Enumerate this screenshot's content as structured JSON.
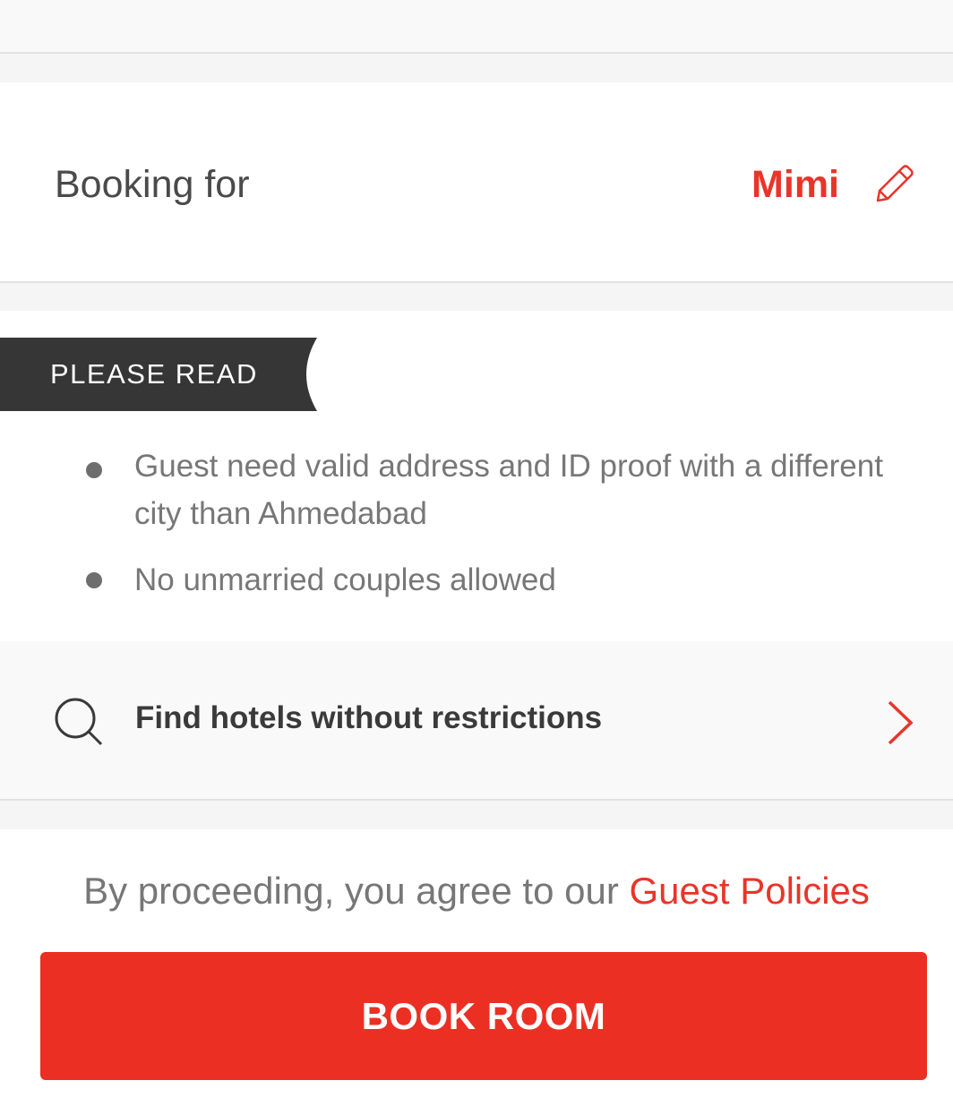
{
  "booking": {
    "label": "Booking for",
    "guest_name": "Mimi",
    "edit_icon": "pencil-icon"
  },
  "notice": {
    "ribbon_label": "PLEASE READ",
    "rules": [
      "Guest need valid address and ID proof with a different city than Ahmedabad",
      "No unmarried couples allowed"
    ]
  },
  "find_hotels": {
    "label": "Find hotels without restrictions",
    "icon": "search-icon",
    "arrow_icon": "chevron-right-icon"
  },
  "footer": {
    "agree_text": "By proceeding, you agree to our ",
    "policy_link": "Guest Policies",
    "book_button": "BOOK ROOM"
  },
  "colors": {
    "accent": "#e8352a",
    "button": "#ec2f23",
    "ribbon": "#363636",
    "text": "#4a4a4a",
    "muted": "#777777"
  }
}
